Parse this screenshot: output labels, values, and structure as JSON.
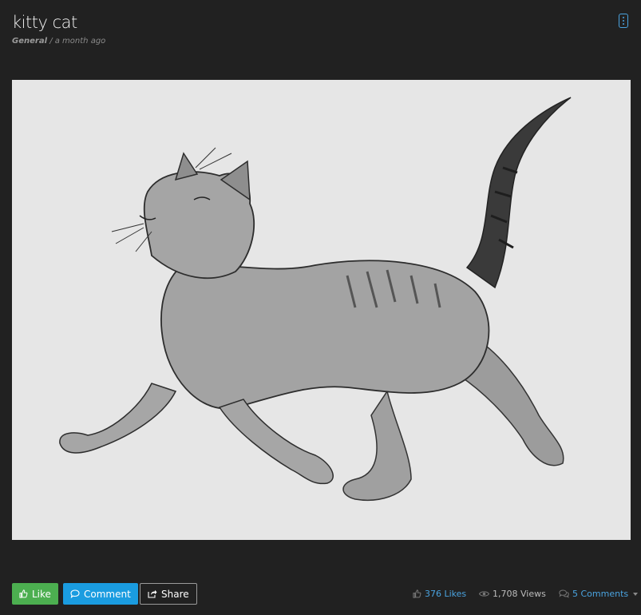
{
  "post": {
    "title": "kitty cat",
    "category": "General",
    "separator": "/",
    "time": "a month ago"
  },
  "menu": {
    "icon": "vertical-dots-icon"
  },
  "image": {
    "subject": "cat"
  },
  "actions": {
    "like_label": "Like",
    "comment_label": "Comment",
    "share_label": "Share"
  },
  "stats": {
    "likes": "376 Likes",
    "views": "1,708 Views",
    "comments": "5 Comments"
  },
  "colors": {
    "background": "#212121",
    "like": "#4caf50",
    "comment": "#1a9ce0",
    "link": "#4aa3df"
  }
}
